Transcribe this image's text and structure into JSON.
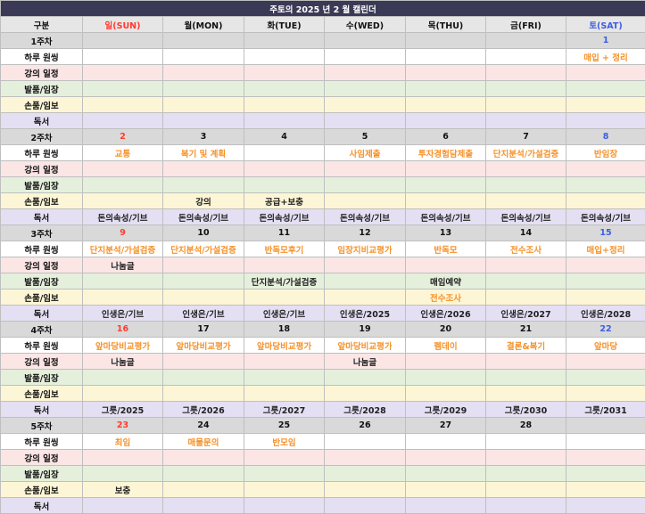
{
  "title": "주토의 2025 년 2 월 캘린더",
  "headers": [
    "구분",
    "일(SUN)",
    "월(MON)",
    "화(TUE)",
    "수(WED)",
    "목(THU)",
    "금(FRI)",
    "토(SAT)"
  ],
  "colors": {
    "title_bg": "#3a3a56",
    "sunday": "#ff3b30",
    "saturday": "#3d5ee0",
    "highlight_orange": "#f5922a"
  },
  "weeks": [
    {
      "label": "1주차",
      "days": [
        "",
        "",
        "",
        "",
        "",
        "",
        "1"
      ],
      "rows": {
        "haru": {
          "label": "하루 원씽",
          "cells": [
            "",
            "",
            "",
            "",
            "",
            "",
            "매입 + 정리"
          ]
        },
        "gangui": {
          "label": "강의 일정",
          "cells": [
            "",
            "",
            "",
            "",
            "",
            "",
            ""
          ]
        },
        "balcum": {
          "label": "발품/임장",
          "cells": [
            "",
            "",
            "",
            "",
            "",
            "",
            ""
          ]
        },
        "sonum": {
          "label": "손품/임보",
          "cells": [
            "",
            "",
            "",
            "",
            "",
            "",
            ""
          ]
        },
        "dokseo": {
          "label": "독서",
          "cells": [
            "",
            "",
            "",
            "",
            "",
            "",
            ""
          ]
        }
      }
    },
    {
      "label": "2주차",
      "days": [
        "2",
        "3",
        "4",
        "5",
        "6",
        "7",
        "8"
      ],
      "rows": {
        "haru": {
          "label": "하루 원씽",
          "cells": [
            "교통",
            "복기 및 계획",
            "",
            "사임제출",
            "투자경험담제출",
            "단지분석/가설검증",
            "반임장"
          ]
        },
        "gangui": {
          "label": "강의 일정",
          "cells": [
            "",
            "",
            "",
            "",
            "",
            "",
            ""
          ]
        },
        "balcum": {
          "label": "발품/임장",
          "cells": [
            "",
            "",
            "",
            "",
            "",
            "",
            ""
          ]
        },
        "sonum": {
          "label": "손품/임보",
          "cells": [
            "",
            "강의",
            "공급+보충",
            "",
            "",
            "",
            ""
          ]
        },
        "dokseo": {
          "label": "독서",
          "cells": [
            "돈의속성/기브",
            "돈의속성/기브",
            "돈의속성/기브",
            "돈의속성/기브",
            "돈의속성/기브",
            "돈의속성/기브",
            "돈의속성/기브"
          ]
        }
      }
    },
    {
      "label": "3주차",
      "days": [
        "9",
        "10",
        "11",
        "12",
        "13",
        "14",
        "15"
      ],
      "rows": {
        "haru": {
          "label": "하루 원씽",
          "cells": [
            "단지분석/가설검증",
            "단지분석/가설검증",
            "반독모후기",
            "임장지비교평가",
            "반독모",
            "전수조사",
            "매입+정리"
          ]
        },
        "gangui": {
          "label": "강의 일정",
          "cells": [
            "나눔글",
            "",
            "",
            "",
            "",
            "",
            ""
          ]
        },
        "balcum": {
          "label": "발품/임장",
          "cells": [
            "",
            "",
            "단지분석/가설검증",
            "",
            "매임예약",
            "",
            ""
          ]
        },
        "sonum": {
          "label": "손품/임보",
          "cells": [
            "",
            "",
            "",
            "",
            "전수조사",
            "",
            ""
          ]
        },
        "dokseo": {
          "label": "독서",
          "cells": [
            "인생은/기브",
            "인생은/기브",
            "인생은/기브",
            "인생은/2025",
            "인생은/2026",
            "인생은/2027",
            "인생은/2028"
          ]
        }
      }
    },
    {
      "label": "4주차",
      "days": [
        "16",
        "17",
        "18",
        "19",
        "20",
        "21",
        "22"
      ],
      "rows": {
        "haru": {
          "label": "하루 원씽",
          "cells": [
            "앞마당비교평가",
            "앞마당비교평가",
            "앞마당비교평가",
            "앞마당비교평가",
            "펨데이",
            "결론&복기",
            "앞마당"
          ]
        },
        "gangui": {
          "label": "강의 일정",
          "cells": [
            "나눔글",
            "",
            "",
            "나눔글",
            "",
            "",
            ""
          ]
        },
        "balcum": {
          "label": "발품/임장",
          "cells": [
            "",
            "",
            "",
            "",
            "",
            "",
            ""
          ]
        },
        "sonum": {
          "label": "손품/임보",
          "cells": [
            "",
            "",
            "",
            "",
            "",
            "",
            ""
          ]
        },
        "dokseo": {
          "label": "독서",
          "cells": [
            "그릇/2025",
            "그릇/2026",
            "그릇/2027",
            "그릇/2028",
            "그릇/2029",
            "그릇/2030",
            "그릇/2031"
          ]
        }
      }
    },
    {
      "label": "5주차",
      "days": [
        "23",
        "24",
        "25",
        "26",
        "27",
        "28",
        ""
      ],
      "rows": {
        "haru": {
          "label": "하루 원씽",
          "cells": [
            "최임",
            "매물문의",
            "반모임",
            "",
            "",
            "",
            ""
          ]
        },
        "gangui": {
          "label": "강의 일정",
          "cells": [
            "",
            "",
            "",
            "",
            "",
            "",
            ""
          ]
        },
        "balcum": {
          "label": "발품/임장",
          "cells": [
            "",
            "",
            "",
            "",
            "",
            "",
            ""
          ]
        },
        "sonum": {
          "label": "손품/임보",
          "cells": [
            "보충",
            "",
            "",
            "",
            "",
            "",
            ""
          ]
        },
        "dokseo": {
          "label": "독서",
          "cells": [
            "",
            "",
            "",
            "",
            "",
            "",
            ""
          ]
        }
      }
    }
  ]
}
